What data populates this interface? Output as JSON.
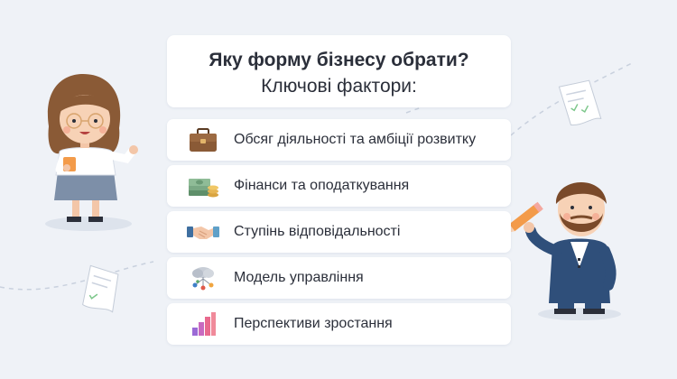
{
  "title": {
    "main": "Яку форму бізнесу обрати?",
    "sub": "Ключові фактори:"
  },
  "factors": [
    {
      "label": "Обсяг діяльності та амбіції розвитку",
      "icon": "briefcase-icon"
    },
    {
      "label": "Фінанси та оподаткування",
      "icon": "money-stack-icon"
    },
    {
      "label": "Ступінь відповідальності",
      "icon": "handshake-icon"
    },
    {
      "label": "Модель управління",
      "icon": "cloud-network-icon"
    },
    {
      "label": "Перспективи зростання",
      "icon": "growth-chart-icon"
    }
  ],
  "colors": {
    "background": "#eff2f7",
    "card": "#ffffff",
    "text": "#2b2f3a",
    "accent_orange": "#f39b4a",
    "suit_blue": "#2f4f7a"
  }
}
